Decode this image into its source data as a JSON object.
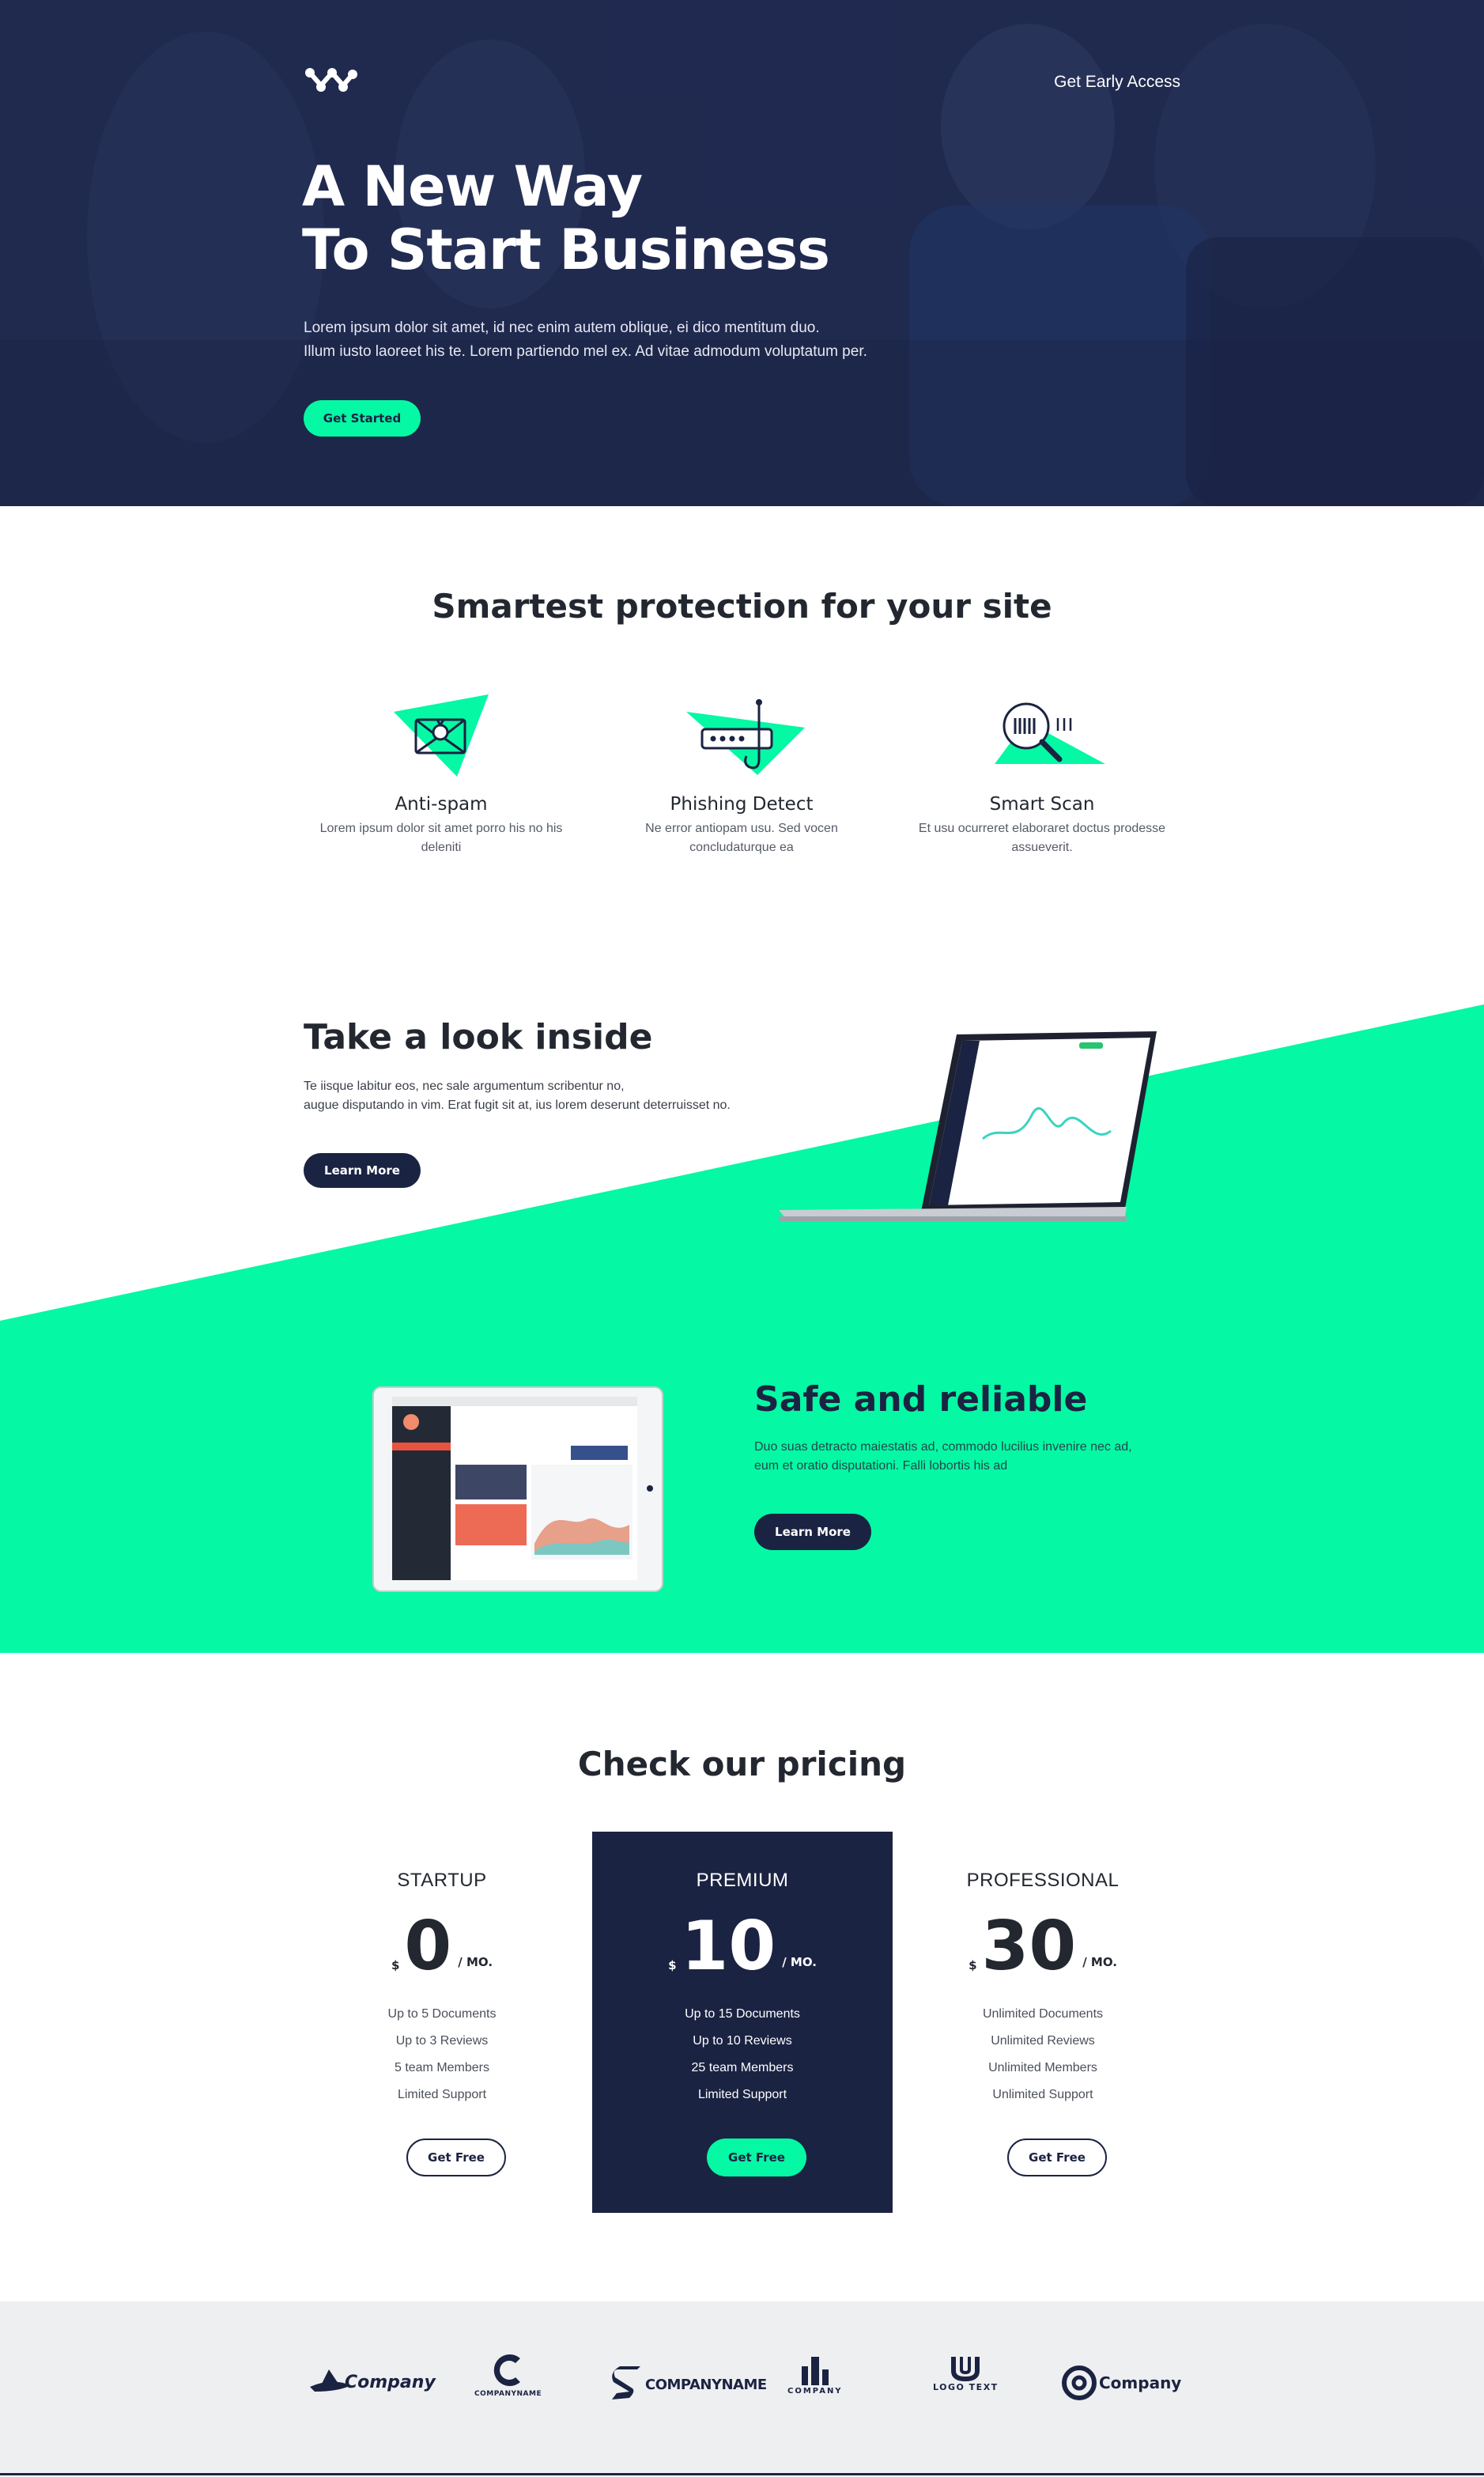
{
  "hero": {
    "nav_link": "Get Early Access",
    "title_line1": "A New Way",
    "title_line2": "To Start Business",
    "subtitle_line1": "Lorem ipsum dolor sit amet, id nec enim autem oblique, ei dico mentitum duo.",
    "subtitle_line2": "Illum iusto laoreet his te. Lorem partiendo mel ex. Ad vitae admodum voluptatum per.",
    "cta": "Get Started"
  },
  "features": {
    "title": "Smartest protection for your site",
    "items": [
      {
        "title": "Anti-spam",
        "text": "Lorem ipsum dolor sit amet porro his no his deleniti",
        "icon": "envelope-bug-icon"
      },
      {
        "title": "Phishing Detect",
        "text": "Ne error antiopam usu. Sed vocen concludaturque ea",
        "icon": "router-hook-icon"
      },
      {
        "title": "Smart Scan",
        "text": "Et usu ocurreret elaboraret doctus prodesse assueverit.",
        "icon": "magnifier-scan-icon"
      }
    ]
  },
  "look_inside": {
    "title": "Take a look inside",
    "text_line1": "Te iisque labitur eos, nec sale argumentum scribentur no,",
    "text_line2": "augue disputando in vim. Erat fugit sit at, ius lorem deserunt deterruisset no.",
    "cta": "Learn More"
  },
  "safe": {
    "title": "Safe and reliable",
    "text_line1": "Duo suas detracto maiestatis ad, commodo lucilius invenire nec ad,",
    "text_line2": "eum et oratio disputationi. Falli lobortis his ad",
    "cta": "Learn More"
  },
  "pricing": {
    "title": "Check our pricing",
    "currency": "$",
    "period": "/ MO.",
    "plans": [
      {
        "name": "STARTUP",
        "price": "0",
        "features": [
          "Up to 5 Documents",
          "Up to 3 Reviews",
          "5 team Members",
          "Limited Support"
        ],
        "cta": "Get Free"
      },
      {
        "name": "PREMIUM",
        "price": "10",
        "features": [
          "Up to 15 Documents",
          "Up to 10 Reviews",
          "25 team Members",
          "Limited Support"
        ],
        "cta": "Get Free"
      },
      {
        "name": "PROFESSIONAL",
        "price": "30",
        "features": [
          "Unlimited Documents",
          "Unlimited Reviews",
          "Unlimited Members",
          "Unlimited Support"
        ],
        "cta": "Get Free"
      }
    ]
  },
  "clients": [
    {
      "name": "Company",
      "icon": "hat-logo-icon"
    },
    {
      "name": "COMPANYNAME",
      "icon": "c-swoosh-logo-icon"
    },
    {
      "name": "COMPANYNAME",
      "icon": "s-logo-icon"
    },
    {
      "name": "COMPANY",
      "icon": "city-logo-icon"
    },
    {
      "name": "LOGO TEXT",
      "icon": "u-logo-icon"
    },
    {
      "name": "Company",
      "icon": "cd-logo-icon"
    }
  ],
  "colors": {
    "accent": "#05f8a4",
    "navy": "#1b2342",
    "text": "#232730",
    "footer_bg": "#eeeff1"
  }
}
